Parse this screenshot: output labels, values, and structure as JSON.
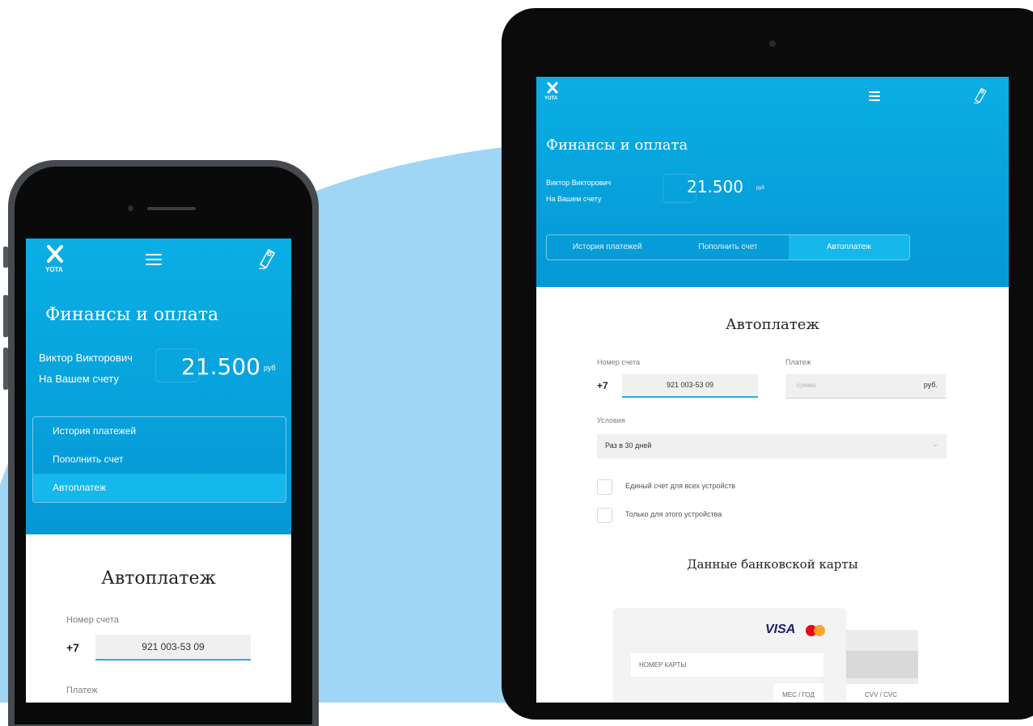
{
  "colors": {
    "brand": "#0aaee4",
    "accent_line": "#21b1e4",
    "background_blob": "#9fd6f5"
  },
  "app": {
    "logo_text": "YOTA",
    "page_title": "Финансы и оплата",
    "user_name": "Виктор Викторович",
    "balance_label": "На Вашем счету",
    "balance_amount": "21.500",
    "balance_currency": "руб",
    "tabs": [
      {
        "label": "История платежей",
        "active": false
      },
      {
        "label": "Пополнить счет",
        "active": false
      },
      {
        "label": "Автоплатеж",
        "active": true
      }
    ],
    "section_title": "Автоплатеж",
    "account_label": "Номер счета",
    "account_prefix": "+7",
    "account_value": "921 003-53 09",
    "payment_label": "Платеж",
    "payment_placeholder": "сумма",
    "payment_currency": "руб.",
    "conditions_label": "Условия",
    "conditions_value": "Раз в 30 дней",
    "checkbox_options": [
      "Единый счет для всех устройств",
      "Только для этого устройства"
    ],
    "card_section_title": "Данные банковской карты",
    "card_brands": [
      "VISA",
      "MasterCard"
    ],
    "card_number_placeholder": "НОМЕР КАРТЫ",
    "card_expiry_placeholder": "МЕС / ГОД",
    "card_cvv_placeholder": "CVV / CVC"
  },
  "icons": {
    "logo": "yota-logo-icon",
    "menu": "hamburger-menu-icon",
    "wallet": "wallet-icon",
    "dropdown": "chevron-down-icon"
  }
}
